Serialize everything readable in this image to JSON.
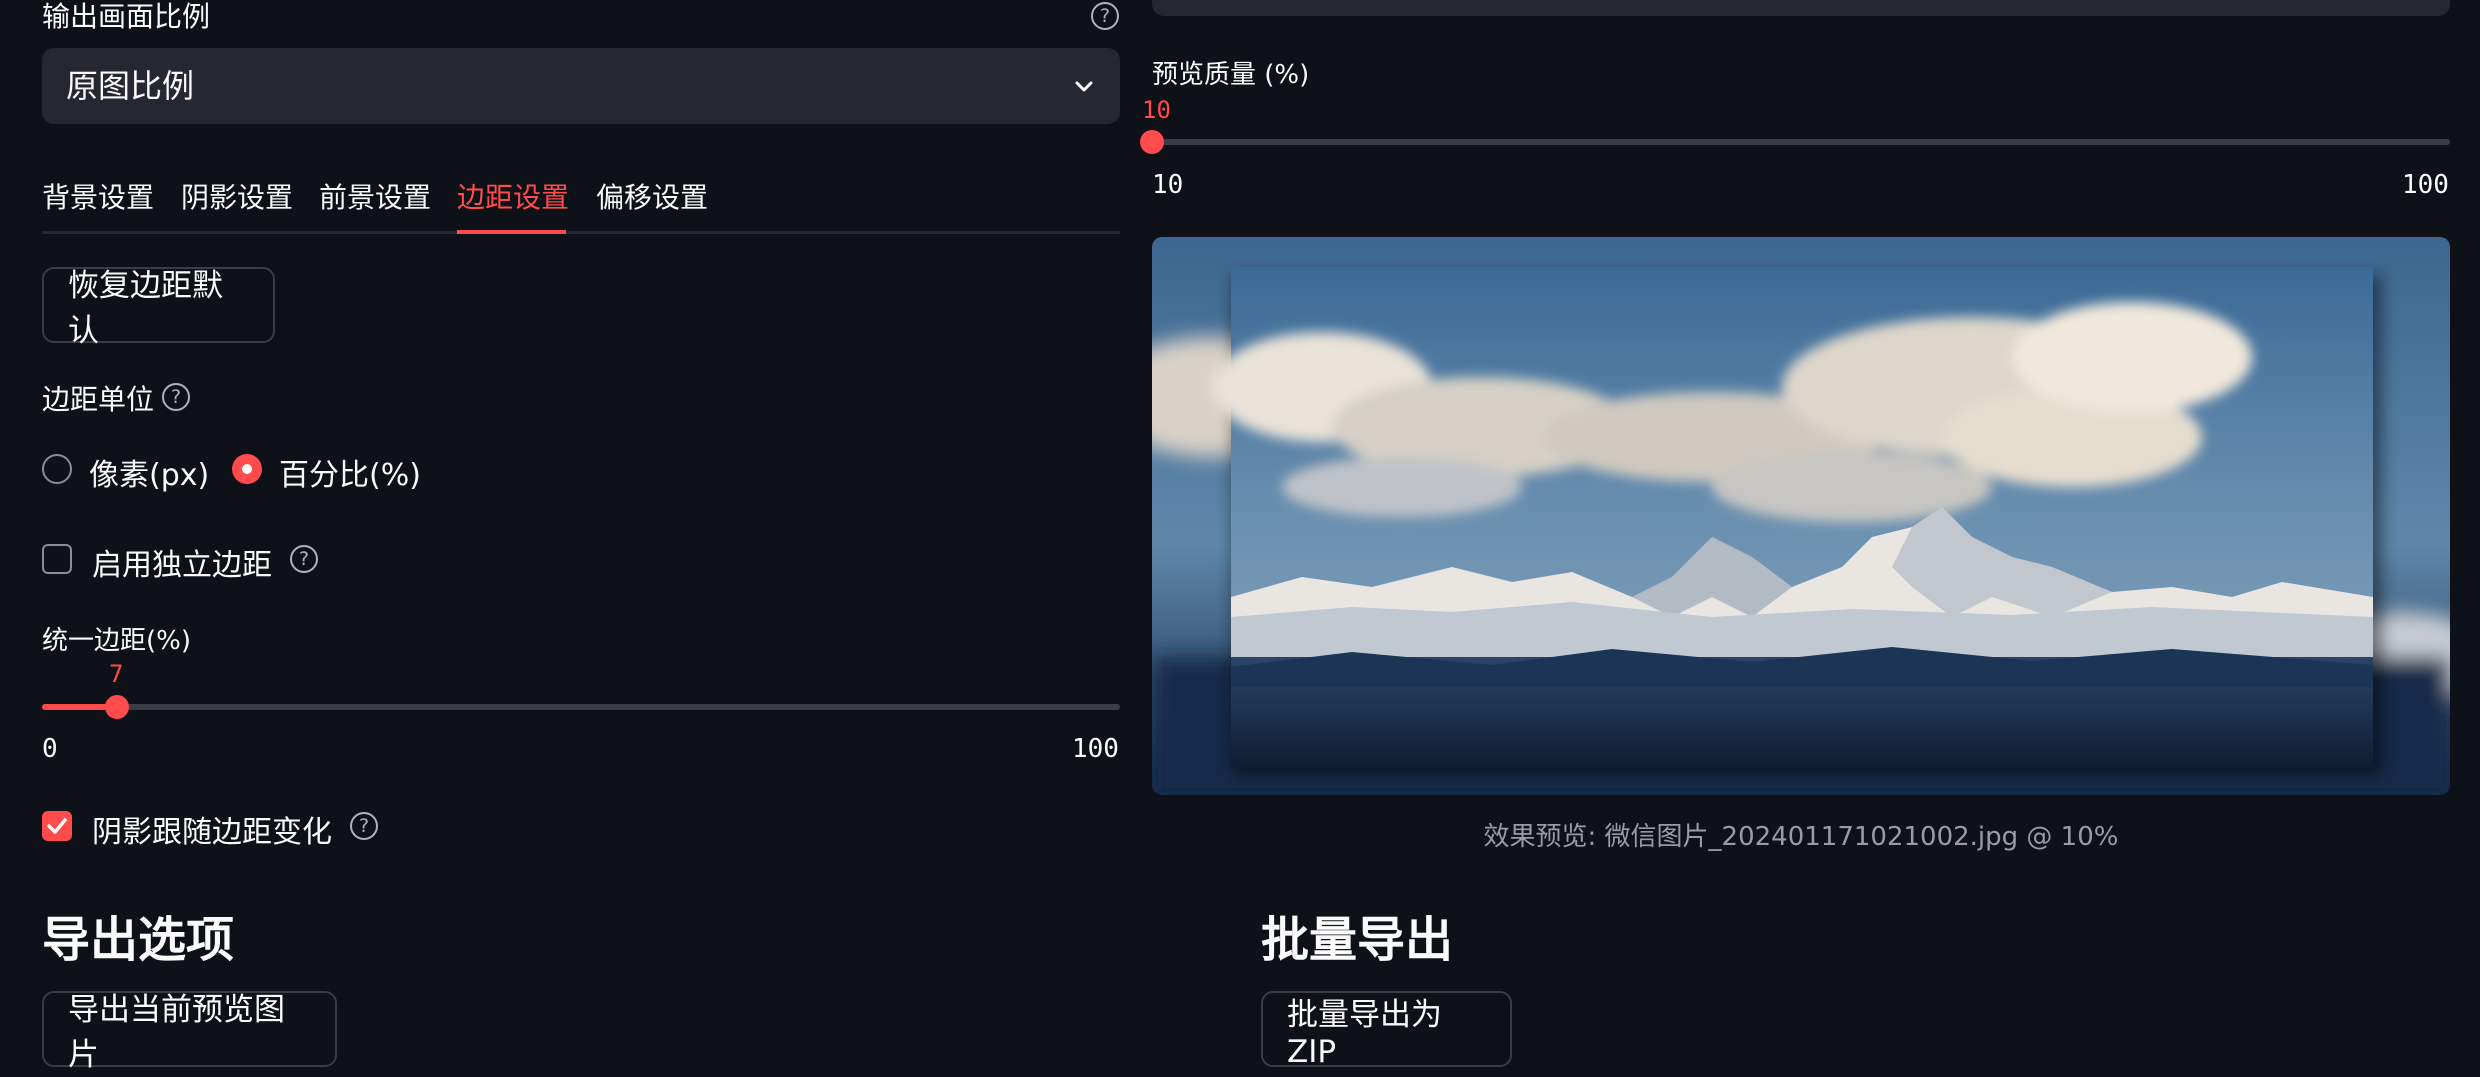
{
  "output_ratio": {
    "label": "输出画面比例",
    "selected": "原图比例"
  },
  "tabs": [
    "背景设置",
    "阴影设置",
    "前景设置",
    "边距设置",
    "偏移设置"
  ],
  "active_tab": "边距设置",
  "margin": {
    "reset_button": "恢复边距默认",
    "unit_label": "边距单位",
    "unit_options": [
      "像素(px)",
      "百分比(%)"
    ],
    "unit_selected": "百分比(%)",
    "independent_label": "启用独立边距",
    "independent_checked": false,
    "uniform_label": "统一边距(%)",
    "uniform_value": "7",
    "uniform_min": "0",
    "uniform_max": "100",
    "shadow_follow_label": "阴影跟随边距变化",
    "shadow_follow_checked": true
  },
  "preview": {
    "quality_label": "预览质量 (%)",
    "quality_value": "10",
    "quality_min": "10",
    "quality_max": "100",
    "caption": "效果预览: 微信图片_202401171021002.jpg @ 10%"
  },
  "export": {
    "title": "导出选项",
    "button": "导出当前预览图片"
  },
  "batch": {
    "title": "批量导出",
    "button": "批量导出为 ZIP"
  },
  "colors": {
    "accent": "#ff4b4b",
    "background": "#0e1117",
    "widget": "#262730"
  }
}
